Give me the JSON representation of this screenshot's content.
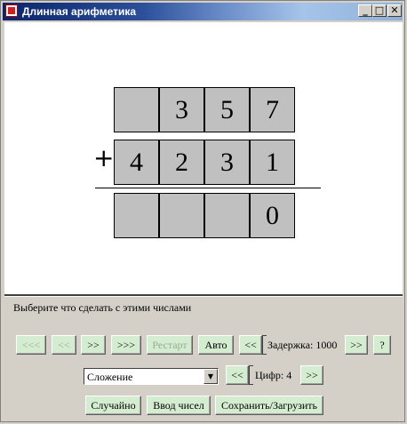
{
  "window": {
    "title": "Длинная арифметика"
  },
  "controls": {
    "minimize": "_",
    "maximize": "□",
    "close": "✕"
  },
  "operation_sign": "+",
  "operand1": [
    "",
    "3",
    "5",
    "7"
  ],
  "operand2": [
    "4",
    "2",
    "3",
    "1"
  ],
  "result": [
    "",
    "",
    "",
    "0"
  ],
  "status": "Выберите что сделать с этими числами",
  "buttons": {
    "first": "<<<",
    "prev": "<<",
    "next": ">>",
    "last": ">>>",
    "restart": "Рестарт",
    "auto": "Авто",
    "delay_dec": "<<",
    "delay_inc": ">>",
    "help": "?",
    "digits_dec": "<<",
    "digits_inc": ">>",
    "random": "Случайно",
    "input": "Ввод чисел",
    "save_load": "Сохранить/Загрузить"
  },
  "delay": {
    "label": "Задержка: 1000"
  },
  "digits": {
    "label": "Цифр: 4"
  },
  "operation": {
    "selected": "Сложение"
  }
}
